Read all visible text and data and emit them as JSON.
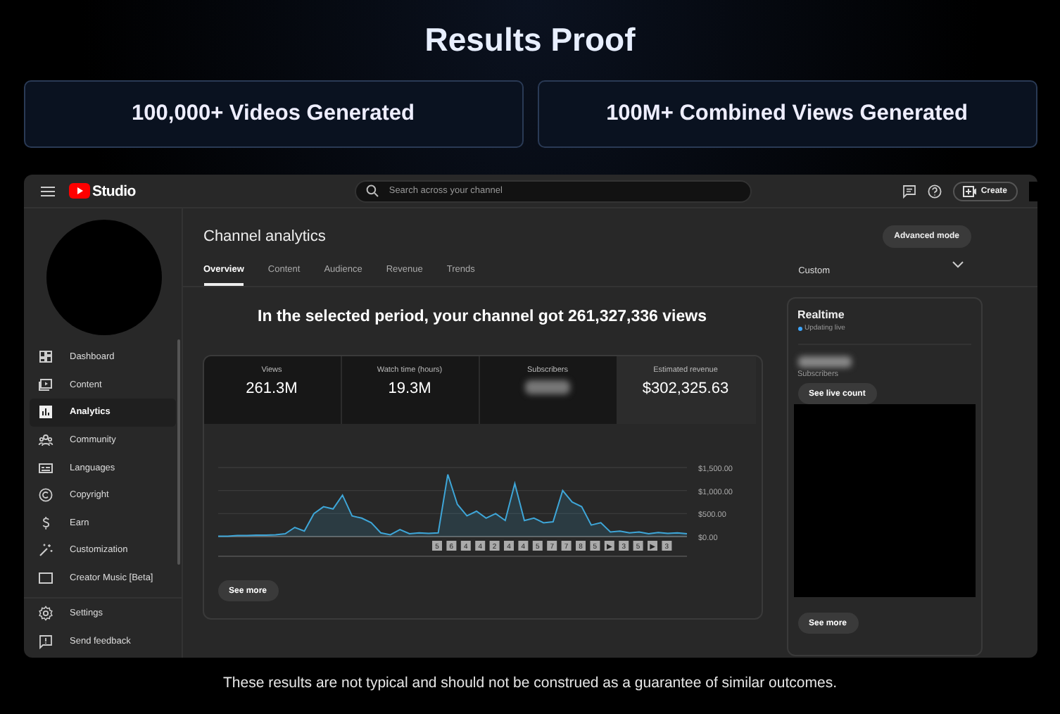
{
  "title": "Results Proof",
  "stats": [
    {
      "label": "100,000+ Videos Generated"
    },
    {
      "label": "100M+ Combined Views Generated"
    }
  ],
  "studio": {
    "logo": "Studio",
    "search": {
      "placeholder": "Search across your channel"
    },
    "create": "Create",
    "nav": [
      {
        "label": "Dashboard",
        "selected": false
      },
      {
        "label": "Content",
        "selected": false
      },
      {
        "label": "Analytics",
        "selected": true
      },
      {
        "label": "Community",
        "selected": false
      },
      {
        "label": "Languages",
        "selected": false
      },
      {
        "label": "Copyright",
        "selected": false
      },
      {
        "label": "Earn",
        "selected": false
      },
      {
        "label": "Customization",
        "selected": false
      },
      {
        "label": "Creator Music [Beta]",
        "selected": false
      }
    ],
    "nav_bottom": [
      {
        "label": "Settings"
      },
      {
        "label": "Send feedback"
      }
    ],
    "page_title": "Channel analytics",
    "advanced": "Advanced mode",
    "tabs": [
      {
        "label": "Overview",
        "selected": true
      },
      {
        "label": "Content",
        "selected": false
      },
      {
        "label": "Audience",
        "selected": false
      },
      {
        "label": "Revenue",
        "selected": false
      },
      {
        "label": "Trends",
        "selected": false
      }
    ],
    "period": "Custom",
    "headline": "In the selected period, your channel got 261,327,336 views",
    "metrics": [
      {
        "label": "Views",
        "value": "261.3M",
        "selected": false,
        "blurred": false
      },
      {
        "label": "Watch time (hours)",
        "value": "19.3M",
        "selected": false,
        "blurred": false
      },
      {
        "label": "Subscribers",
        "selected": false,
        "blurred": true
      },
      {
        "label": "Estimated revenue",
        "value": "$302,325.63",
        "selected": true,
        "blurred": false
      }
    ],
    "chart_data": {
      "type": "area",
      "ylim": [
        0,
        1500
      ],
      "yticks": [
        {
          "value": 0,
          "label": "$0.00"
        },
        {
          "value": 500,
          "label": "$500.00"
        },
        {
          "value": 1000,
          "label": "$1,000.00"
        },
        {
          "value": 1500,
          "label": "$1,500.00"
        }
      ],
      "series": [
        {
          "color": "#3ea6d8",
          "values": [
            10,
            10,
            20,
            20,
            30,
            30,
            40,
            60,
            200,
            120,
            500,
            650,
            600,
            900,
            450,
            400,
            300,
            80,
            40,
            150,
            60,
            80,
            70,
            80,
            1350,
            700,
            450,
            550,
            400,
            500,
            350,
            1150,
            350,
            400,
            300,
            320,
            1000,
            750,
            650,
            250,
            300,
            100,
            120,
            80,
            100,
            60,
            90,
            70,
            80,
            60
          ]
        }
      ]
    },
    "markers": [
      "5",
      "6",
      "4",
      "4",
      "2",
      "4",
      "4",
      "5",
      "7",
      "7",
      "8",
      "5",
      "▶",
      "3",
      "5",
      "▶",
      "3"
    ],
    "see_more": "See more",
    "realtime": {
      "title": "Realtime",
      "status": "Updating live",
      "label": "Subscribers",
      "button": "See live count",
      "see_more": "See more"
    }
  },
  "disclaimer": "These results are not typical and should not be construed as a guarantee of similar outcomes."
}
